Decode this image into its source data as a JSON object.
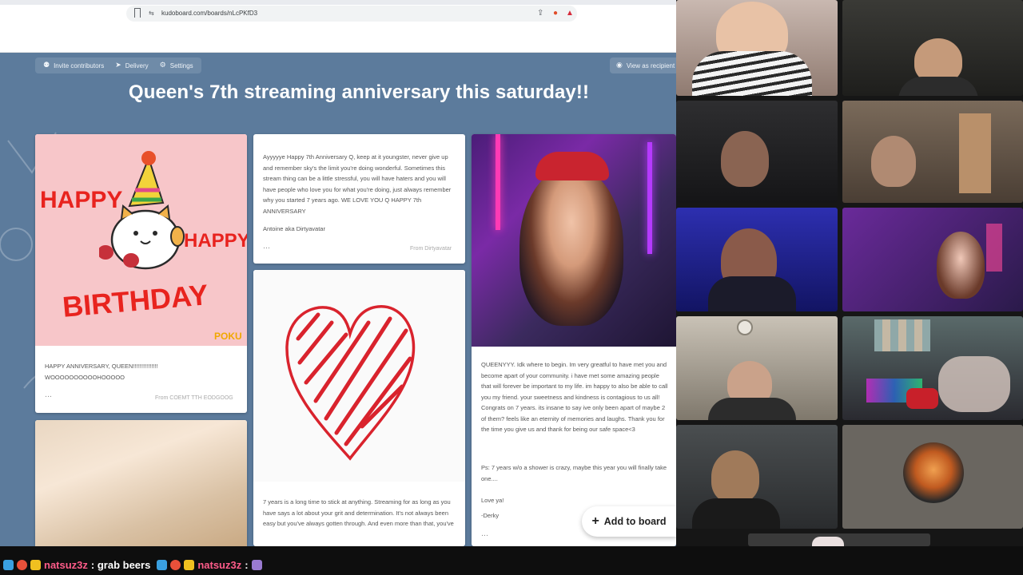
{
  "browser": {
    "url": "kudoboard.com/boards/nLcPKfD3"
  },
  "board": {
    "title": "Queen's 7th streaming anniversary this saturday!!",
    "toolbar": {
      "invite": "Invite contributors",
      "delivery": "Delivery",
      "settings": "Settings",
      "view_as": "View as recipient"
    },
    "add_button": "Add to board",
    "posts": [
      {
        "image_text": [
          "HAPPY",
          "HAPPY",
          "BIRTHDAY",
          "POKU"
        ],
        "message": "HAPPY ANNIVERSARY, QUEEN!!!!!!!!!!!!!!! WOOOOOOOOOOHOOOOO",
        "from": "From COEMT TTH EODGOOG"
      },
      {
        "message": "Ayyyyye Happy 7th Anniversary Q, keep at it youngster, never give up and remember sky's the limit you're doing wonderful. Sometimes this stream thing can be a little stressful, you will have haters and you will have people who love you for what you're doing, just always remember why you started 7 years ago. WE LOVE YOU Q HAPPY 7th ANNIVERSARY",
        "signature": "Antoine aka Dirtyavatar",
        "from": "From Dirtyavatar"
      },
      {
        "message": "QUEENYYY. Idk where to begin. Im very greatful to have met you and become apart of your community. i have met some amazing people that will forever be important to my life. im happy to also be able to call you my friend. your sweetness and kindness is contagious to us all! Congrats on 7 years. its insane to say ive only been apart of maybe 2 of them? feels like an eternity of memories and laughs. Thank you for the time you give us and thank for being our safe space<3",
        "ps": "Ps: 7 years w/o a shower is crazy, maybe this year you will finally take one....",
        "closing": "Love ya!",
        "signature": "-Derky"
      },
      {
        "message": "7 years is a long time to stick at anything. Streaming for as long as you have says a lot about your grit and determination. It's not always been easy but you've always gotten through. And even more than that, you've"
      }
    ]
  },
  "chat": {
    "messages": [
      {
        "user": "natsuz3z",
        "text": ": grab beers"
      },
      {
        "user": "natsuz3z",
        "text": ":"
      }
    ]
  },
  "colors": {
    "board_bg": "#5c7b9c",
    "card_pink": "#f7c6c9",
    "heart_red": "#d9232d",
    "chat_user": "#ff5c8a"
  }
}
